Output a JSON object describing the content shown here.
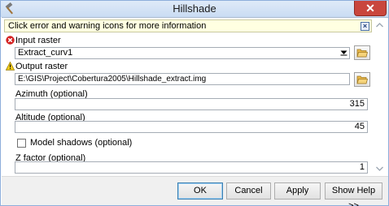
{
  "window": {
    "title": "Hillshade"
  },
  "info_bar": {
    "text": "Click error and warning icons for more information"
  },
  "form": {
    "input_raster": {
      "label": "Input raster",
      "value": "Extract_curv1"
    },
    "output_raster": {
      "label": "Output raster",
      "value": "E:\\GIS\\Project\\Cobertura2005\\Hillshade_extract.img"
    },
    "azimuth": {
      "label": "Azimuth (optional)",
      "value": "315"
    },
    "altitude": {
      "label": "Altitude (optional)",
      "value": "45"
    },
    "model_shadows": {
      "label": "Model shadows (optional)",
      "checked": false
    },
    "z_factor": {
      "label": "Z factor (optional)",
      "value": "1"
    }
  },
  "buttons": {
    "ok": "OK",
    "cancel": "Cancel",
    "apply": "Apply",
    "show_help": "Show Help >>"
  },
  "icons": {
    "app": "hammer-icon",
    "error": "error-icon",
    "warning": "warning-icon",
    "folder": "open-folder-icon"
  },
  "colors": {
    "info_bar_background": "#ffffe1",
    "close_button": "#c9463d",
    "error_red": "#d42020",
    "warning_yellow": "#f2cc1c"
  }
}
